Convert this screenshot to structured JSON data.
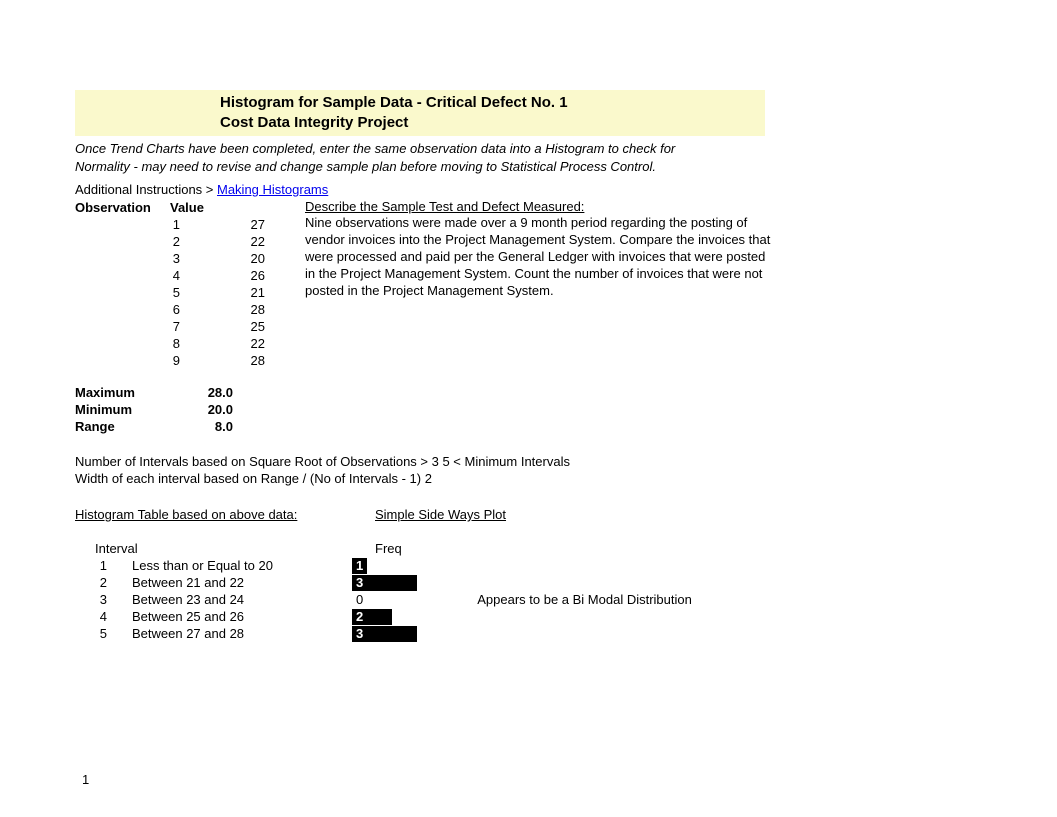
{
  "title_line1": "Histogram for Sample Data - Critical Defect No. 1",
  "title_line2": "Cost Data Integrity Project",
  "instruction_line1": "Once Trend Charts have been completed, enter the same observation data into a Histogram to check for",
  "instruction_line2": "Normality - may need to revise and change sample plan before moving to Statistical Process Control.",
  "additional_instructions_label": "Additional Instructions >  ",
  "additional_instructions_link": "Making Histograms",
  "obs_header_1": "Observation",
  "obs_header_2": "Value",
  "observations": [
    {
      "n": "1",
      "v": "27"
    },
    {
      "n": "2",
      "v": "22"
    },
    {
      "n": "3",
      "v": "20"
    },
    {
      "n": "4",
      "v": "26"
    },
    {
      "n": "5",
      "v": "21"
    },
    {
      "n": "6",
      "v": "28"
    },
    {
      "n": "7",
      "v": "25"
    },
    {
      "n": "8",
      "v": "22"
    },
    {
      "n": "9",
      "v": "28"
    }
  ],
  "desc_title": "Describe the Sample Test and Defect Measured:",
  "desc_body": "Nine observations were made over a 9 month period regarding the posting of vendor invoices into the Project Management System. Compare the invoices that were processed and paid per the General Ledger with invoices that were posted in the Project Management System. Count the number of invoices that were not posted in the Project Management System.",
  "stats": {
    "max_label": "Maximum",
    "max_val": "28.0",
    "min_label": "Minimum",
    "min_val": "20.0",
    "range_label": "Range",
    "range_val": "8.0"
  },
  "intervals_line1_a": "Number of Intervals based on Square Root of Observations >  3   5  < Minimum Intervals",
  "intervals_line2_a": "Width of each interval based on Range / (No of Intervals - 1)    2",
  "hist_title1": "Histogram Table based on above data:",
  "hist_title2": "Simple Side Ways Plot",
  "hist_col_interval": "Interval",
  "hist_col_freq": "Freq",
  "hist_rows": [
    {
      "n": "1",
      "label": "Less than or Equal to 20",
      "freq": "1",
      "bar": 0
    },
    {
      "n": "2",
      "label": "Between 21 and 22",
      "freq": "3",
      "bar": 50
    },
    {
      "n": "3",
      "label": "Between 23 and 24",
      "freq": "0",
      "bar": 0,
      "note": "Appears to be a Bi Modal Distribution"
    },
    {
      "n": "4",
      "label": "Between 25 and 26",
      "freq": "2",
      "bar": 25
    },
    {
      "n": "5",
      "label": "Between 27 and 28",
      "freq": "3",
      "bar": 50
    }
  ],
  "page_number": "1",
  "chart_data": {
    "type": "bar",
    "title": "Simple Side Ways Plot",
    "categories": [
      "Less than or Equal to 20",
      "Between 21 and 22",
      "Between 23 and 24",
      "Between 25 and 26",
      "Between 27 and 28"
    ],
    "values": [
      1,
      3,
      0,
      2,
      3
    ],
    "xlabel": "Freq",
    "ylabel": "Interval"
  }
}
